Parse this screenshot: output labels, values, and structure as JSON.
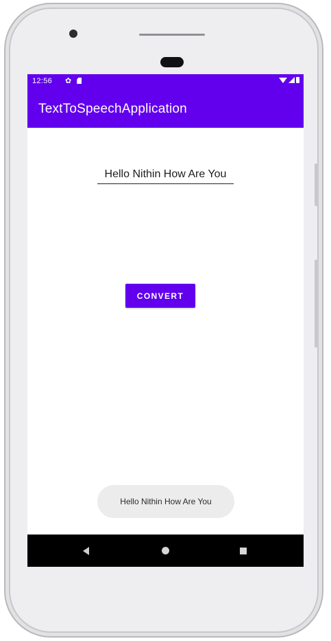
{
  "status_bar": {
    "time": "12:56",
    "icons": [
      "settings-icon",
      "sd-card-icon",
      "wifi-icon",
      "signal-icon",
      "battery-icon"
    ]
  },
  "app_bar": {
    "title": "TextToSpeechApplication"
  },
  "main": {
    "text_input_value": "Hello Nithin How Are You",
    "convert_label": "CONVERT"
  },
  "toast": {
    "message": "Hello Nithin How Are You"
  },
  "nav_bar": {
    "icons": [
      "back-icon",
      "home-icon",
      "recents-icon"
    ]
  },
  "colors": {
    "primary": "#6200ee",
    "nav_bar": "#000000",
    "toast_bg": "#ececec"
  }
}
